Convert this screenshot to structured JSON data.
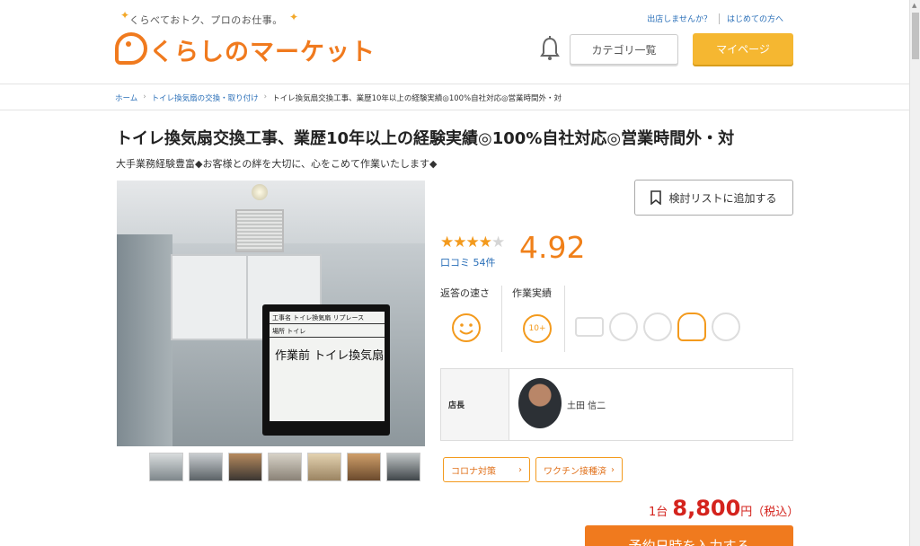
{
  "header": {
    "tagline": "くらべておトク、プロのお仕事。",
    "logo_text": "くらしのマーケット",
    "links": [
      "出店しませんか？",
      "はじめての方へ"
    ],
    "category_button": "カテゴリ一覧",
    "mypage_button": "マイページ"
  },
  "breadcrumb": [
    "ホーム",
    "トイレ換気扇の交換・取り付け",
    "トイレ換気扇交換工事、業歴10年以上の経験実績◎100%自社対応◎営業時間外・対"
  ],
  "title": "トイレ換気扇交換工事、業歴10年以上の経験実績◎100%自社対応◎営業時間外・対",
  "subtitle": "大手業務経験豊富◆お客様との絆を大切に、心をこめて作業いたします◆",
  "photo": {
    "board_row1": "工事名 トイレ換気扇 リプレース",
    "board_row2": "場所 トイレ",
    "board_hand": "作業前 トイレ換気扇",
    "thumb_count": 7
  },
  "list_button": "検討リストに追加する",
  "rating": {
    "stars_filled": 4,
    "stars_total": 5,
    "score": "4.92",
    "review_label": "口コミ 54件"
  },
  "metrics": {
    "speed_label": "返答の速さ",
    "record_label": "作業実績",
    "record_badge": "10+"
  },
  "owner": {
    "label": "店長",
    "name": "土田 信二"
  },
  "chips": [
    "コロナ対策",
    "ワクチン接種済"
  ],
  "price": {
    "unit": "1台",
    "amount": "8,800",
    "suffix": "円（税込）"
  },
  "cta": "予約日時を入力する",
  "colors": {
    "brand_orange": "#f07a1e",
    "mypage_yellow": "#f5b731",
    "link_blue": "#2a6fb8",
    "price_red": "#d4231d"
  }
}
